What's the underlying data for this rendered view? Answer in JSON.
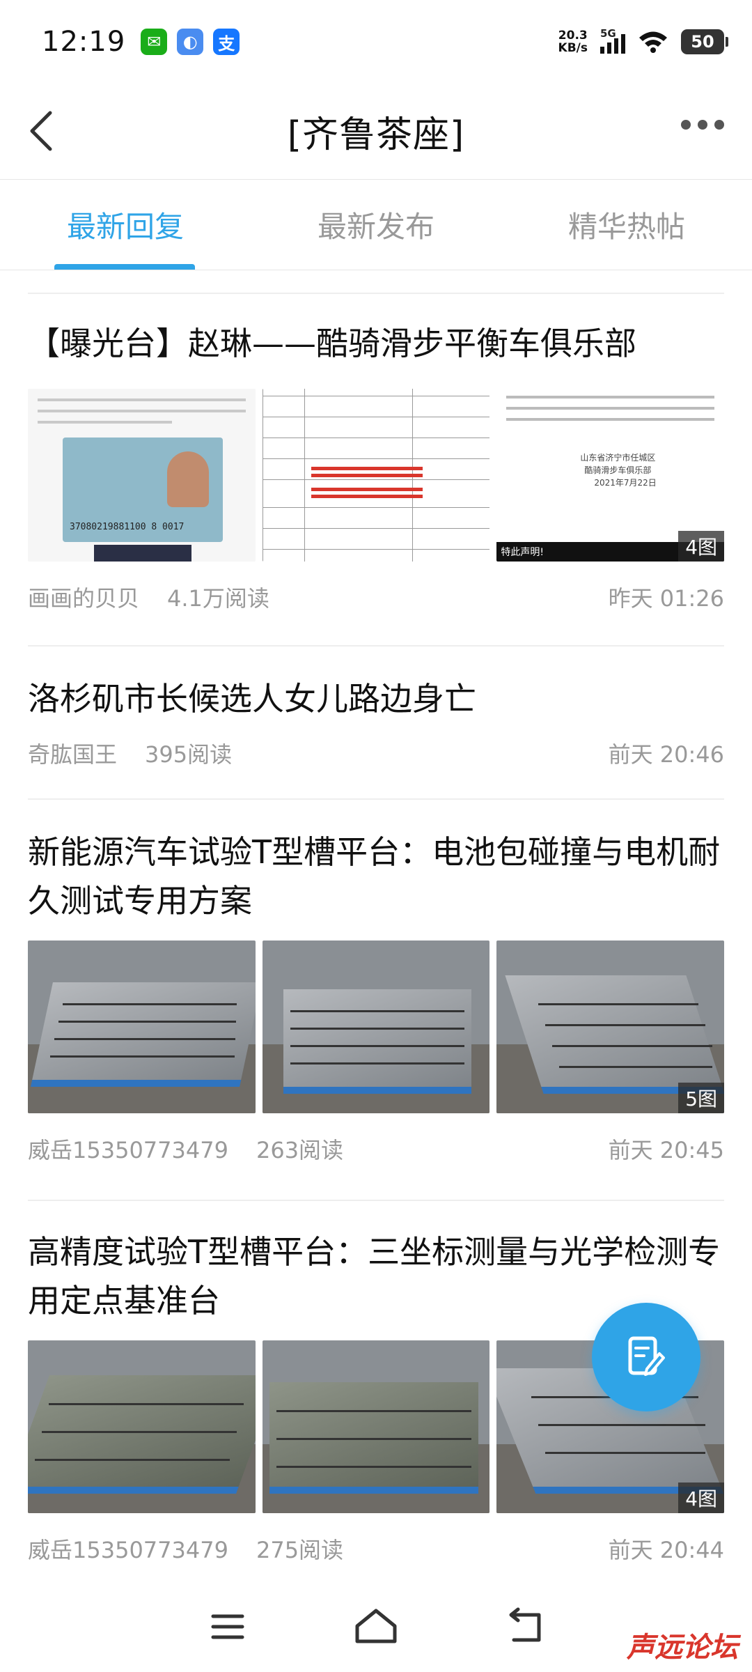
{
  "status": {
    "time": "12:19",
    "speed_value": "20.3",
    "speed_unit": "KB/s",
    "net_type": "5G",
    "battery": "50"
  },
  "nav": {
    "title": "[齐鲁茶座]"
  },
  "tabs": [
    {
      "label": "最新回复"
    },
    {
      "label": "最新发布"
    },
    {
      "label": "精华热帖"
    }
  ],
  "posts": [
    {
      "title": "【曝光台】赵琳——酷骑滑步平衡车俱乐部",
      "author": "画画的贝贝",
      "reads": "4.1万阅读",
      "time": "昨天 01:26",
      "image_count": "4图",
      "thumb_texts": {
        "id_number": "37080219881100 8 0017",
        "notice": "特此声明!",
        "org_line1": "山东省济宁市任城区",
        "org_line2": "酷骑滑步车俱乐部",
        "date": "2021年7月22日"
      }
    },
    {
      "title": "洛杉矶市长候选人女儿路边身亡",
      "author": "奇肱国王",
      "reads": "395阅读",
      "time": "前天 20:46"
    },
    {
      "title": "新能源汽车试验T型槽平台：电池包碰撞与电机耐久测试专用方案",
      "author": "威岳15350773479",
      "reads": "263阅读",
      "time": "前天 20:45",
      "image_count": "5图"
    },
    {
      "title": "高精度试验T型槽平台：三坐标测量与光学检测专用定点基准台",
      "author": "威岳15350773479",
      "reads": "275阅读",
      "time": "前天 20:44",
      "image_count": "4图"
    }
  ],
  "watermark": "声远论坛",
  "colors": {
    "accent": "#2fa4e7"
  }
}
